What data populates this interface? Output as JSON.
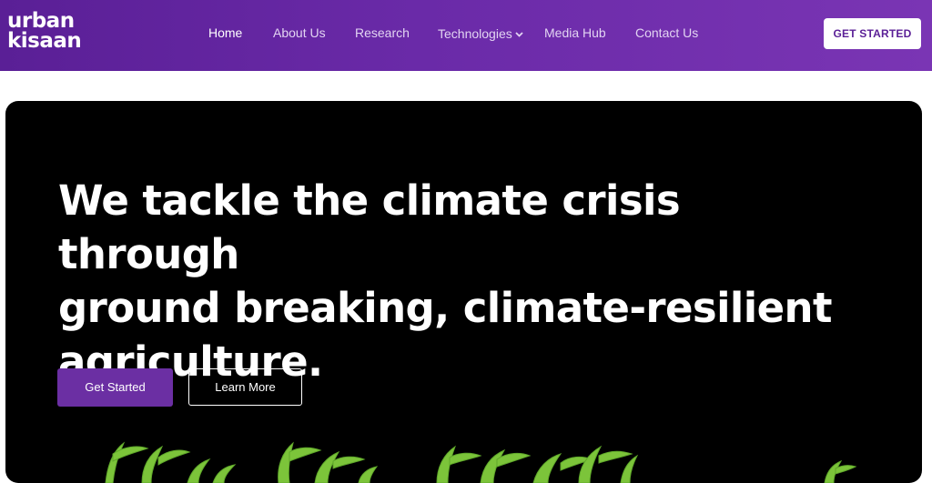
{
  "header": {
    "logo_line1": "urban",
    "logo_line2": "kisaan",
    "nav": [
      {
        "label": "Home",
        "active": true
      },
      {
        "label": "About Us"
      },
      {
        "label": "Research"
      },
      {
        "label": "Technologies",
        "has_dropdown": true
      },
      {
        "label": "Media Hub"
      },
      {
        "label": "Contact Us"
      }
    ],
    "cta_label": "GET STARTED"
  },
  "hero": {
    "headline_line1": "We tackle the climate crisis through",
    "headline_line2": "ground breaking, climate-resilient",
    "headline_line3": "agriculture.",
    "primary_button": "Get Started",
    "secondary_button": "Learn More"
  },
  "colors": {
    "brand": "#6b2fa3",
    "header_gradient_start": "#5a1f96",
    "header_gradient_end": "#7a35b4",
    "hero_background": "#000000",
    "sprout_green": "#7cc43a"
  },
  "icons": {
    "technologies_dropdown": "chevron-down-icon",
    "hero_image": "microgreens-sprouts"
  }
}
